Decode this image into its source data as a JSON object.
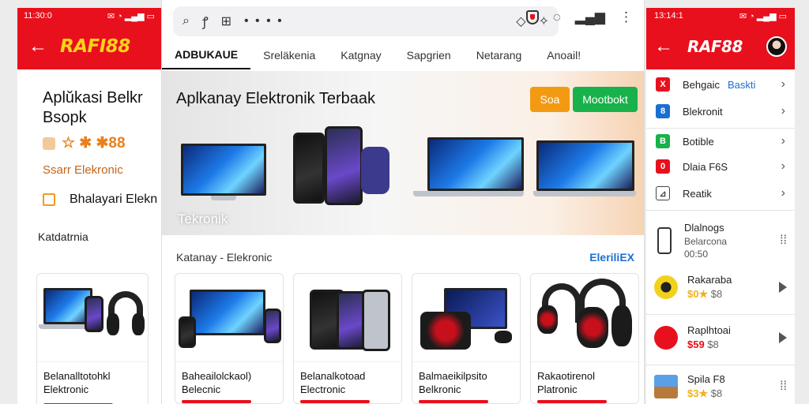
{
  "left": {
    "status": {
      "time": "11:30:0",
      "icons": "✉ ◔ ▂▄▆ ▭"
    },
    "brand": "RAFI88",
    "title_line1": "Aplŭkasi Belkr",
    "title_line2": "Bsopk",
    "brand2": "☆ ✱ ✱88",
    "subtitle": "Ssarr Elekronic",
    "checkbox_label": "Bhalayari Elekn",
    "category": "Katdatrnia",
    "card": {
      "line1": "Belanalltotohkl",
      "line2": "Elektronic"
    }
  },
  "center": {
    "search_placeholder": "• • • •",
    "tabs": [
      "ADBUKAUE",
      "Sreläkenia",
      "Katgnay",
      "Sapgrien",
      "Netarang",
      "Anoail!"
    ],
    "hero": {
      "title": "Aplkanay Elektronik Terbaak",
      "button_orange": "Soa",
      "button_green": "Mootbokt",
      "label": "Tekronik"
    },
    "section_title": "Katanay - Elekronic",
    "section_link": "EleriliEX",
    "cards": [
      {
        "line1": "Baheailolckaol)",
        "line2": "Belecnic"
      },
      {
        "line1": "Belanalkotoad",
        "line2": "Electronic"
      },
      {
        "line1": "Balmaeikilpsito",
        "line2": "Belkronic"
      },
      {
        "line1": "Rakaotirenol",
        "line2": "Platronic"
      }
    ]
  },
  "right": {
    "status": {
      "time": "13:14:1",
      "icons": "✉ ◔ ▂▄▆ ▭"
    },
    "brand": "RAF88",
    "menu": [
      {
        "label": "Behgaic",
        "extra": "Baskti",
        "color": "#e8101c",
        "icon": "X"
      },
      {
        "label": "Blekronit",
        "extra": "",
        "color": "#1b6fd0",
        "icon": "8"
      },
      {
        "label": "Botible",
        "extra": "",
        "color": "#18b14a",
        "icon": "B"
      },
      {
        "label": "Dlaia F6S",
        "extra": "",
        "color": "#e8101c",
        "icon": "0"
      },
      {
        "label": "Reatik",
        "extra": "",
        "color": "#444444",
        "icon": "⊿"
      }
    ],
    "products": [
      {
        "name": "Dlalnogs",
        "line2": "Belarcona",
        "line3": "00:50",
        "price": "",
        "price2": ""
      },
      {
        "name": "Rakaraba",
        "line2": "",
        "line3": "",
        "price": "$0★",
        "price2": "$8"
      },
      {
        "name": "Raplhtoai",
        "line2": "",
        "line3": "",
        "price": "$59",
        "price2": "$8"
      },
      {
        "name": "Spila F8",
        "line2": "",
        "line3": "",
        "price": "$3★",
        "price2": "$8"
      }
    ]
  }
}
